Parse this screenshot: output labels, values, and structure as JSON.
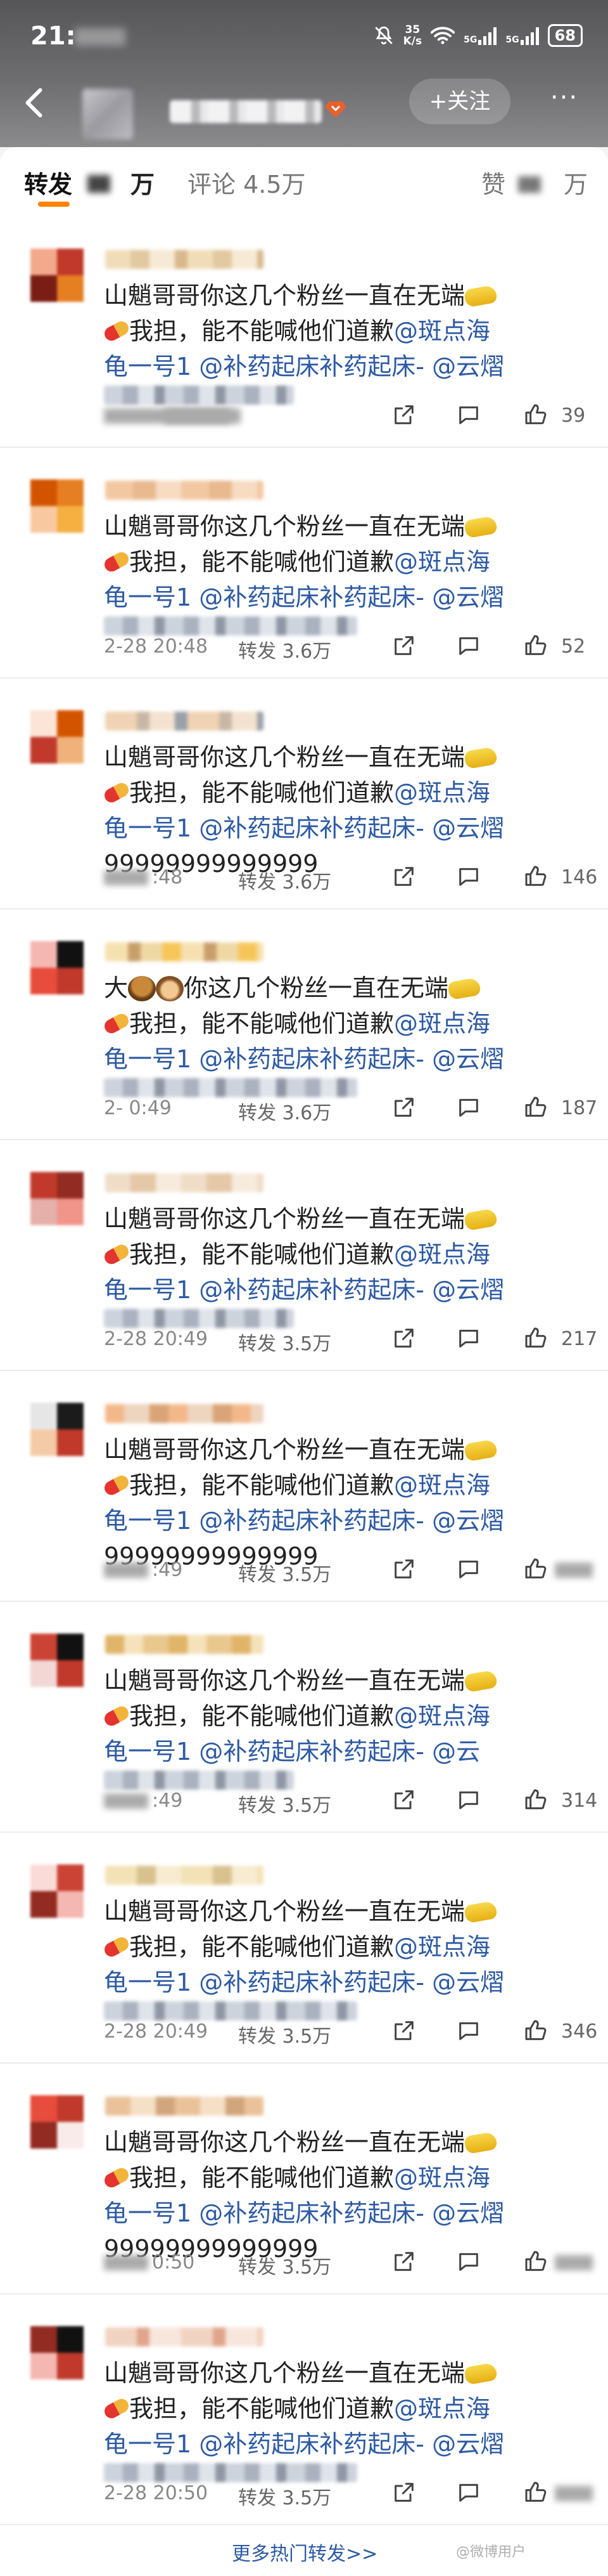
{
  "status_bar": {
    "time": "21:",
    "net_speed_value": "35",
    "net_speed_unit": "K/s",
    "network_1": "5G",
    "network_2": "5G",
    "battery": "68"
  },
  "nav": {
    "follow_label": "+关注",
    "more_label": "···"
  },
  "tabs": {
    "repost_label": "转发",
    "repost_unit": "万",
    "comment_label": "评论 4.5万",
    "like_label": "赞",
    "like_unit": "万"
  },
  "repost_items": [
    {
      "line1": "山魈哥哥你这几个粉丝一直在无端",
      "line2_mid": "我担，能不能喊他们道歉",
      "line2_mention": "@斑点海",
      "line3_a": "龟一号1 ",
      "line3_mention1": "@补药起床补药起床-",
      "line3_mention2": " @云熠",
      "line4": "",
      "time": "",
      "repost_count": "",
      "like_count": "39"
    },
    {
      "line1": "山魈哥哥你这几个粉丝一直在无端",
      "line2_mid": "我担，能不能喊他们道歉",
      "line2_mention": "@斑点海",
      "line3_a": "龟一号1 ",
      "line3_mention1": "@补药起床补药起床-",
      "line3_mention2": " @云熠",
      "line4": "",
      "time": "2-28 20:48",
      "repost_count": "转发 3.6万",
      "like_count": "52"
    },
    {
      "line1": "山魈哥哥你这几个粉丝一直在无端",
      "line2_mid": "我担，能不能喊他们道歉",
      "line2_mention": "@斑点海",
      "line3_a": "龟一号1 ",
      "line3_mention1": "@补药起床补药起床-",
      "line3_mention2": " @云熠",
      "line4": "99999999999999",
      "time": ":48",
      "repost_count": "转发 3.6万",
      "like_count": "146"
    },
    {
      "line1": "大",
      "line1_rest": "你这几个粉丝一直在无端",
      "line2_mid": "我担，能不能喊他们道歉",
      "line2_mention": "@斑点海",
      "line3_a": "龟一号1 ",
      "line3_mention1": "@补药起床补药起床-",
      "line3_mention2": " @云熠",
      "line4": "",
      "time": "2-   0:49",
      "repost_count": "转发 3.6万",
      "like_count": "187"
    },
    {
      "line1": "山魈哥哥你这几个粉丝一直在无端",
      "line2_mid": "我担，能不能喊他们道歉",
      "line2_mention": "@斑点海",
      "line3_a": "龟一号1 ",
      "line3_mention1": "@补药起床补药起床-",
      "line3_mention2": " @云熠",
      "line4": "",
      "time": "2-28 20:49",
      "repost_count": "转发 3.5万",
      "like_count": "217"
    },
    {
      "line1": "山魈哥哥你这几个粉丝一直在无端",
      "line2_mid": "我担，能不能喊他们道歉",
      "line2_mention": "@斑点海",
      "line3_a": "龟一号1 ",
      "line3_mention1": "@补药起床补药起床-",
      "line3_mention2": " @云熠",
      "line4": "99999999999999",
      "time": ":49",
      "repost_count": "转发 3.5万",
      "like_count": ""
    },
    {
      "line1": "山魈哥哥你这几个粉丝一直在无端",
      "line2_mid": "我担，能不能喊他们道歉",
      "line2_mention": "@斑点海",
      "line3_a": "龟一号1 ",
      "line3_mention1": "@补药起床补药起床-",
      "line3_mention2": " @云",
      "line4": "",
      "time": ":49",
      "repost_count": "转发 3.5万",
      "like_count": "314"
    },
    {
      "line1": "山魈哥哥你这几个粉丝一直在无端",
      "line2_mid": "我担，能不能喊他们道歉",
      "line2_mention": "@斑点海",
      "line3_a": "龟一号1 ",
      "line3_mention1": "@补药起床补药起床-",
      "line3_mention2": " @云熠",
      "line4": "",
      "time": "2-28 20:49",
      "repost_count": "转发 3.5万",
      "like_count": "346"
    },
    {
      "line1": "山魈哥哥你这几个粉丝一直在无端",
      "line2_mid": "我担，能不能喊他们道歉",
      "line2_mention": "@斑点海",
      "line3_a": "龟一号1 ",
      "line3_mention1": "@补药起床补药起床-",
      "line3_mention2": " @云熠",
      "line4": "99999999999999",
      "time": "0:50",
      "repost_count": "转发 3.5万",
      "like_count": ""
    },
    {
      "line1": "山魈哥哥你这几个粉丝一直在无端",
      "line2_mid": "我担，能不能喊他们道歉",
      "line2_mention": "@斑点海",
      "line3_a": "龟一号1 ",
      "line3_mention1": "@补药起床补药起床-",
      "line3_mention2": " @云熠",
      "line4": "",
      "time": "2-28 20:50",
      "repost_count": "转发 3.5万",
      "like_count": ""
    }
  ],
  "more_hot_label": "更多热门转发>>",
  "watermark": "@微博用户"
}
